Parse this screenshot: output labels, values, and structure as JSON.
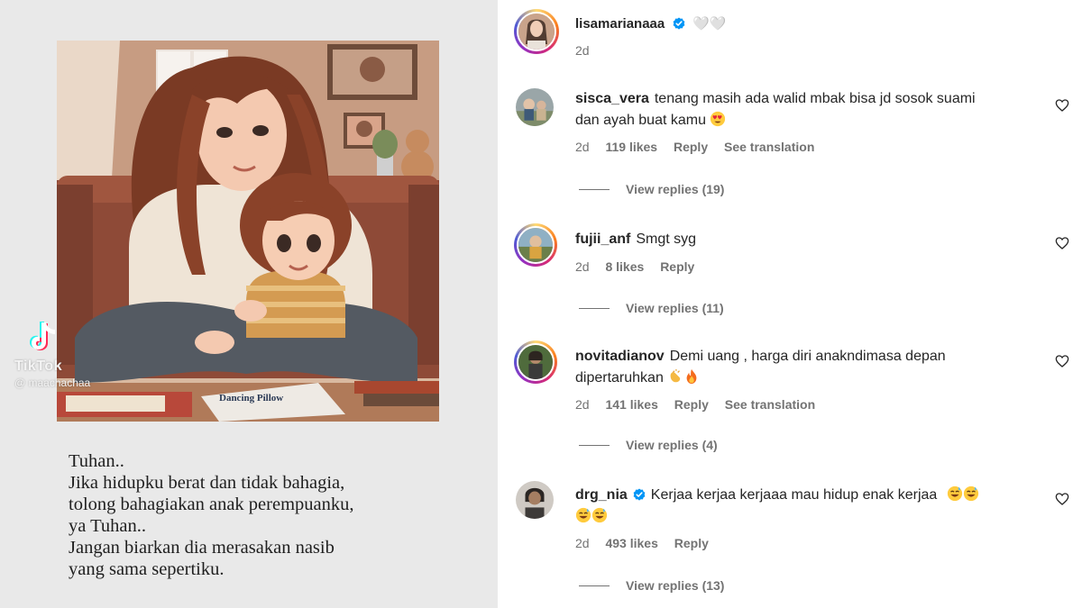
{
  "post": {
    "watermark": {
      "brand": "TikTok",
      "user": "@ maachachaa"
    },
    "caption_lines": [
      "Tuhan..",
      "Jika hidupku berat dan tidak bahagia,",
      "tolong bahagiakan anak perempuanku,",
      "ya Tuhan..",
      "Jangan biarkan dia merasakan nasib",
      "yang sama sepertiku."
    ],
    "book_title": "Dancing Pillow"
  },
  "author": {
    "username": "lisamarianaaa",
    "verified": true,
    "text": "🤍🤍",
    "time": "2d"
  },
  "comments": [
    {
      "username": "sisca_vera",
      "text": "tenang masih ada walid mbak bisa jd sosok suami dan ayah buat kamu",
      "emoji": [
        "heart-eyes"
      ],
      "time": "2d",
      "likes": "119 likes",
      "reply": "Reply",
      "translation": "See translation",
      "view_replies": "View replies (19)"
    },
    {
      "username": "fujii_anf",
      "text": "Smgt syg",
      "emoji": [],
      "time": "2d",
      "likes": "8 likes",
      "reply": "Reply",
      "view_replies": "View replies (11)"
    },
    {
      "username": "novitadianov",
      "text": "Demi uang , harga diri anakndimasa depan dipertaruhkan",
      "emoji": [
        "clap",
        "fire"
      ],
      "time": "2d",
      "likes": "141 likes",
      "reply": "Reply",
      "translation": "See translation",
      "view_replies": "View replies (4)"
    },
    {
      "username": "drg_nia",
      "verified": true,
      "text": "Kerjaa kerjaa kerjaaa mau hidup enak kerjaa",
      "emoji": [
        "sweat-smile",
        "sweat-smile",
        "sweat-smile",
        "sweat-smile"
      ],
      "time": "2d",
      "likes": "493 likes",
      "reply": "Reply",
      "view_replies": "View replies (13)"
    }
  ],
  "colors": {
    "verified_blue": "#0095f6",
    "secondary_text": "#737373",
    "panel_gray": "#e9e9e9"
  }
}
